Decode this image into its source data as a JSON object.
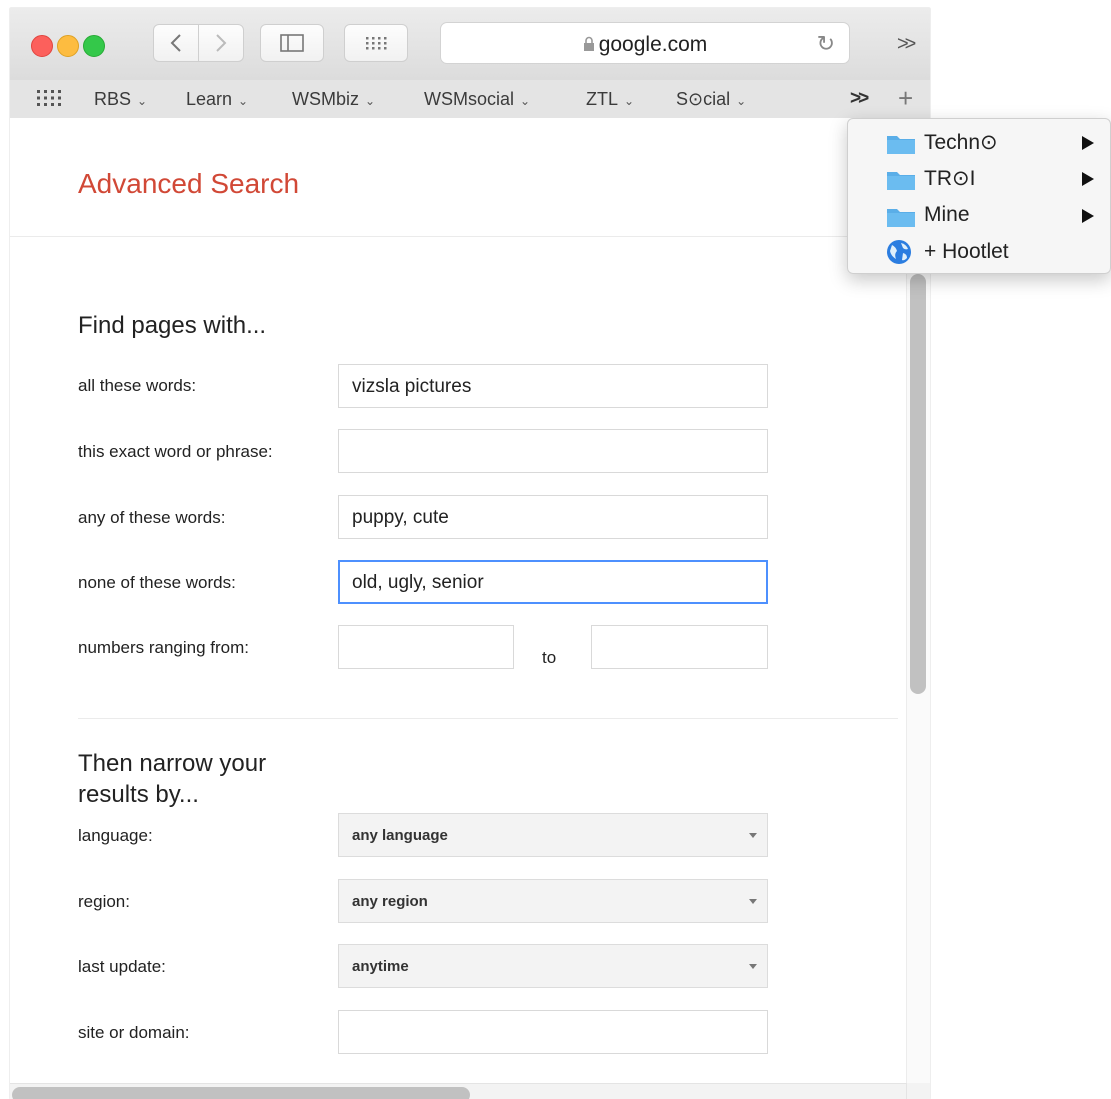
{
  "browser": {
    "address": "google.com",
    "favorites": [
      {
        "label": "RBS"
      },
      {
        "label": "Learn"
      },
      {
        "label": "WSMbiz"
      },
      {
        "label": "WSMsocial"
      },
      {
        "label": "ZTL"
      },
      {
        "label": "S⊙cial"
      }
    ],
    "more_label": ">>",
    "favorites_more_label": ">>"
  },
  "menu": {
    "items": [
      {
        "label": "Techn⊙",
        "icon": "folder-icon",
        "submenu": true
      },
      {
        "label": "TR⊙I",
        "icon": "folder-icon",
        "submenu": true
      },
      {
        "label": "Mine",
        "icon": "folder-icon",
        "submenu": true
      },
      {
        "label": "+ Hootlet",
        "icon": "globe-icon",
        "submenu": false
      }
    ]
  },
  "page": {
    "title": "Advanced Search",
    "find_heading": "Find pages with...",
    "fields": {
      "all_words": {
        "label": "all these words:",
        "value": "vizsla pictures"
      },
      "exact_phrase": {
        "label": "this exact word or phrase:",
        "value": ""
      },
      "any_words": {
        "label": "any of these words:",
        "value": "puppy, cute"
      },
      "none_words": {
        "label": "none of these words:",
        "value": "old, ugly, senior"
      },
      "numbers": {
        "label": "numbers ranging from:",
        "from": "",
        "to_label": "to",
        "to": ""
      }
    },
    "narrow_heading": "Then narrow your results by...",
    "filters": {
      "language": {
        "label": "language:",
        "value": "any language"
      },
      "region": {
        "label": "region:",
        "value": "any region"
      },
      "last_update": {
        "label": "last update:",
        "value": "anytime"
      },
      "site": {
        "label": "site or domain:",
        "value": ""
      }
    }
  },
  "colors": {
    "title_red": "#d14836",
    "focus_blue": "#4d90fe",
    "folder_blue": "#5aaee8"
  }
}
